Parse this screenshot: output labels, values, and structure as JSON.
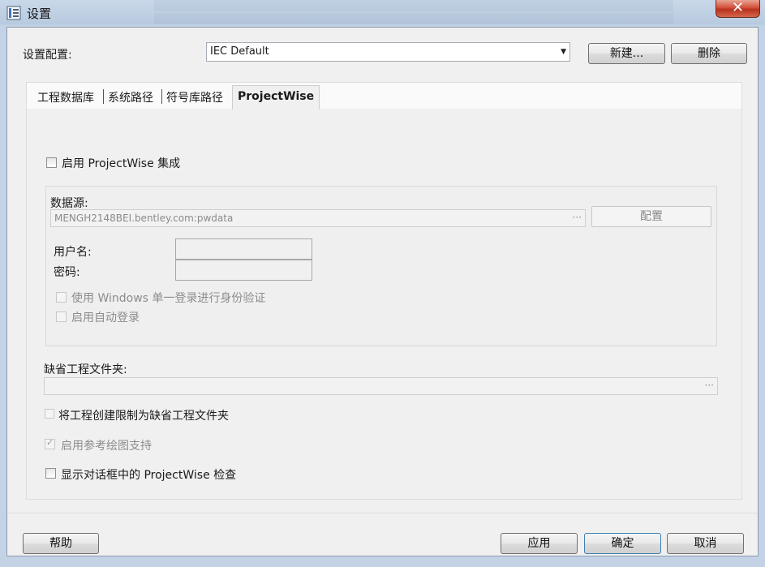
{
  "window": {
    "title": "设置",
    "close_glyph": "✕"
  },
  "config": {
    "label": "设置配置:",
    "selected": "IEC Default",
    "new_button": "新建...",
    "delete_button": "删除"
  },
  "tabs": [
    {
      "label": "工程数据库",
      "selected": false
    },
    {
      "label": "系统路径",
      "selected": false
    },
    {
      "label": "符号库路径",
      "selected": false
    },
    {
      "label": "ProjectWise",
      "selected": true
    }
  ],
  "projectwise": {
    "enable_label": "启用 ProjectWise 集成",
    "datasource_label": "数据源:",
    "datasource_value": "MENGH2148BEI.bentley.com:pwdata",
    "browse_glyph": "···",
    "configure_button": "配置",
    "username_label": "用户名:",
    "password_label": "密码:",
    "windows_sso_label": "使用 Windows 单一登录进行身份验证",
    "auto_login_label": "启用自动登录",
    "default_folder_label": "缺省工程文件夹:",
    "folder_browse_glyph": "···",
    "restrict_label": "将工程创建限制为缺省工程文件夹",
    "reference_label": "启用参考绘图支持",
    "show_check_label": "显示对话框中的 ProjectWise 检查"
  },
  "footer": {
    "help": "帮助",
    "apply": "应用",
    "ok": "确定",
    "cancel": "取消"
  },
  "icons": {
    "app": "settings-app-icon",
    "dropdown": "chevron-down-icon",
    "check": "checkmark-icon"
  }
}
